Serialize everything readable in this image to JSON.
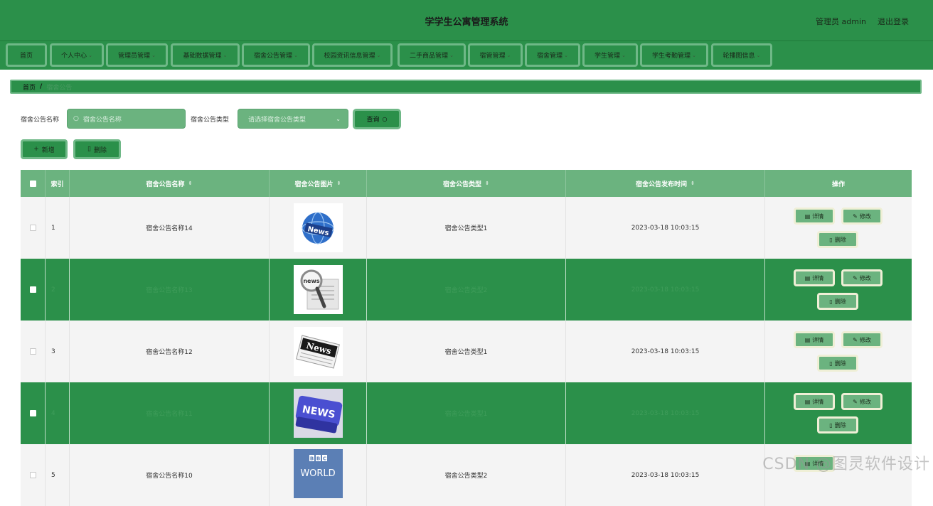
{
  "header": {
    "title": "学学生公寓管理系统",
    "user": "管理员 admin",
    "logout": "退出登录"
  },
  "nav": [
    {
      "label": "首页",
      "chevron": false
    },
    {
      "label": "个人中心",
      "chevron": true
    },
    {
      "label": "管理员管理",
      "chevron": true
    },
    {
      "label": "基础数据管理",
      "chevron": true
    },
    {
      "label": "宿舍公告管理",
      "chevron": true
    },
    {
      "label": "校园资讯信息管理",
      "chevron": true
    },
    {
      "label": "二手商品管理",
      "chevron": true
    },
    {
      "label": "宿管管理",
      "chevron": true
    },
    {
      "label": "宿舍管理",
      "chevron": true
    },
    {
      "label": "学生管理",
      "chevron": true
    },
    {
      "label": "学生考勤管理",
      "chevron": true
    },
    {
      "label": "轮播图信息",
      "chevron": true
    }
  ],
  "breadcrumb": {
    "home": "首页",
    "sep": "/",
    "current": "宿舍公告"
  },
  "search": {
    "name_label": "宿舍公告名称",
    "name_placeholder": "宿舍公告名称",
    "type_label": "宿舍公告类型",
    "type_placeholder": "请选择宿舍公告类型",
    "query": "查询"
  },
  "actions": {
    "add": "新增",
    "delete": "删除"
  },
  "table": {
    "headers": {
      "index": "索引",
      "name": "宿舍公告名称",
      "image": "宿舍公告图片",
      "type": "宿舍公告类型",
      "time": "宿舍公告发布时间",
      "ops": "操作"
    },
    "rows": [
      {
        "index": "1",
        "name": "宿舍公告名称14",
        "type": "宿舍公告类型1",
        "time": "2023-03-18 10:03:15",
        "image": "globe-news",
        "highlight": false
      },
      {
        "index": "2",
        "name": "宿舍公告名称13",
        "type": "宿舍公告类型2",
        "time": "2023-03-18 10:03:15",
        "image": "magnifier-news",
        "highlight": true
      },
      {
        "index": "3",
        "name": "宿舍公告名称12",
        "type": "宿舍公告类型1",
        "time": "2023-03-18 10:03:15",
        "image": "newspaper-news",
        "highlight": false
      },
      {
        "index": "4",
        "name": "宿舍公告名称11",
        "type": "宿舍公告类型1",
        "time": "2023-03-18 10:03:15",
        "image": "key-news",
        "highlight": true
      },
      {
        "index": "5",
        "name": "宿舍公告名称10",
        "type": "宿舍公告类型2",
        "time": "2023-03-18 10:03:15",
        "image": "bbc-world",
        "highlight": false
      }
    ],
    "row_buttons": {
      "detail": "详情",
      "edit": "修改",
      "delete": "删除"
    }
  },
  "watermark": "CSDN @图灵软件设计",
  "colors": {
    "primary": "#2b904a",
    "light": "#6bb37f",
    "border": "#6fb887",
    "op_border": "#efefd6"
  }
}
